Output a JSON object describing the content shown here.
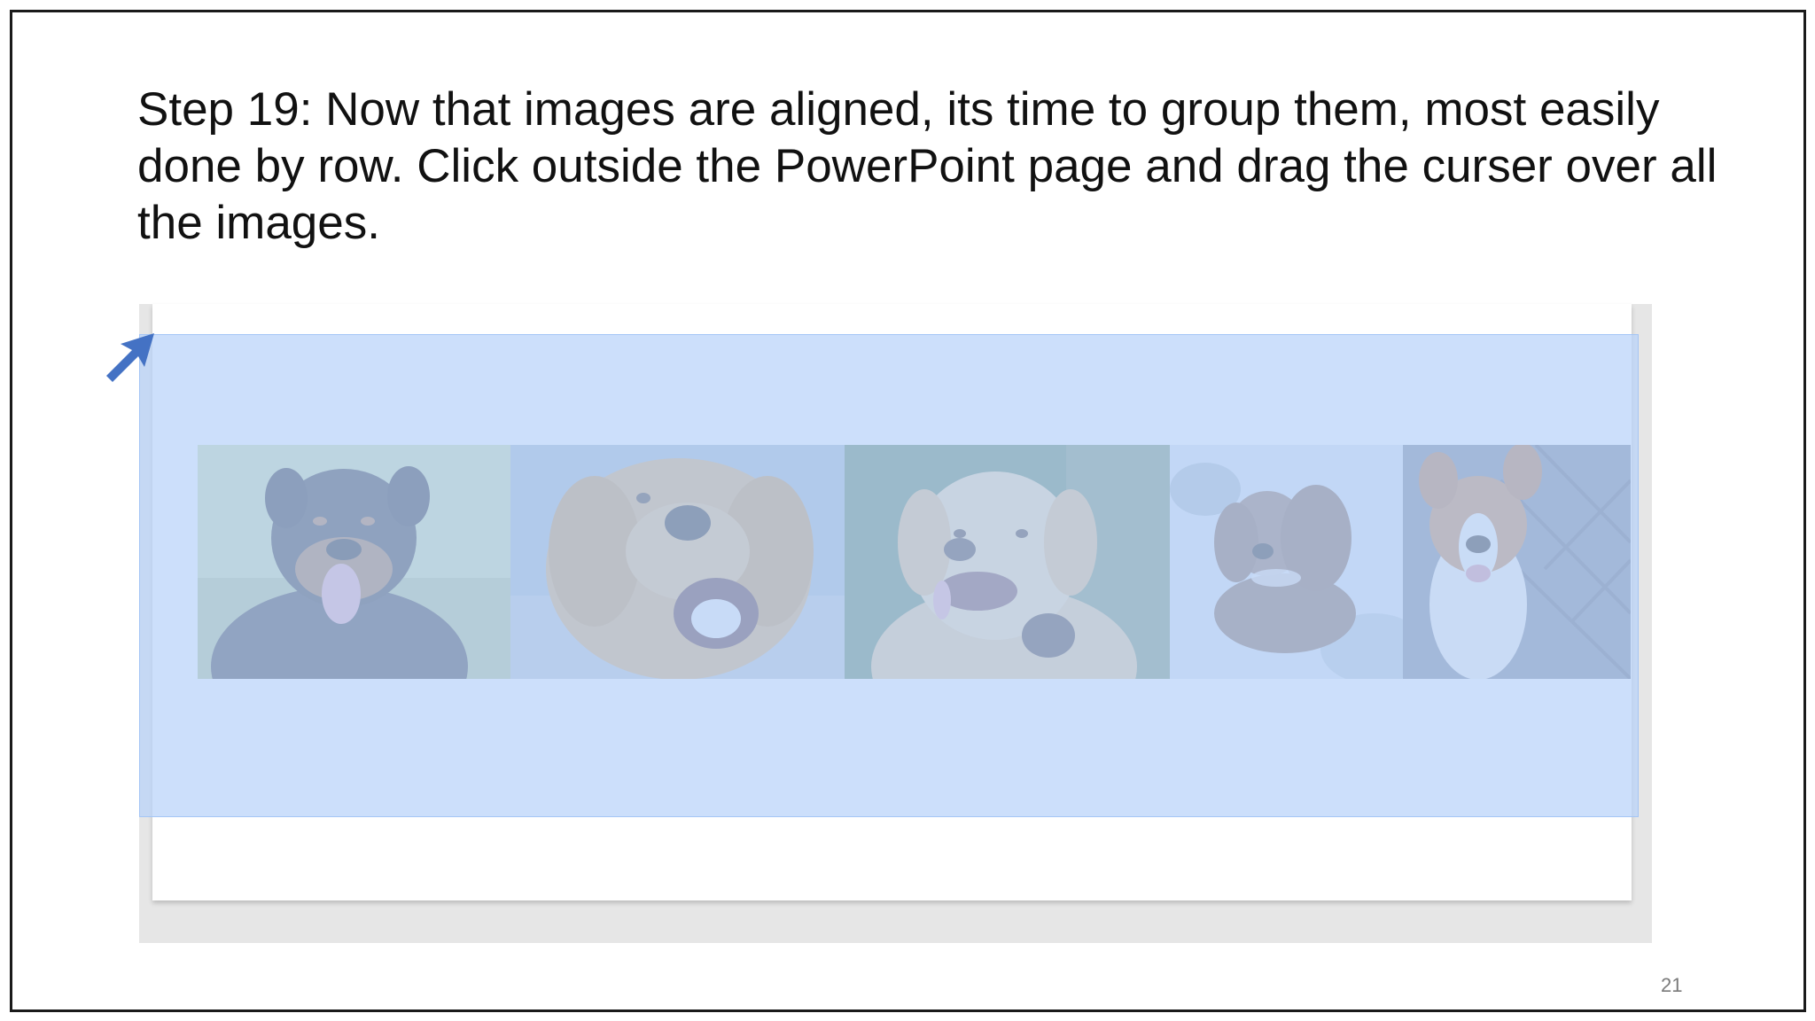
{
  "slide": {
    "instruction": "Step 19: Now that images are aligned, its time to group them, most easily done by row. Click outside the PowerPoint page and drag the curser over all the images.",
    "page_number": "21"
  },
  "screenshot": {
    "photos": [
      {
        "icon": "rottweiler-photo"
      },
      {
        "icon": "golden-retriever-photo"
      },
      {
        "icon": "labrador-photo"
      },
      {
        "icon": "poodle-photo"
      },
      {
        "icon": "beagle-mix-photo"
      }
    ],
    "selection_color": "#b9d3fa"
  },
  "annotation": {
    "arrow_color": "#4472c4",
    "icon": "pointer-arrow-icon"
  }
}
